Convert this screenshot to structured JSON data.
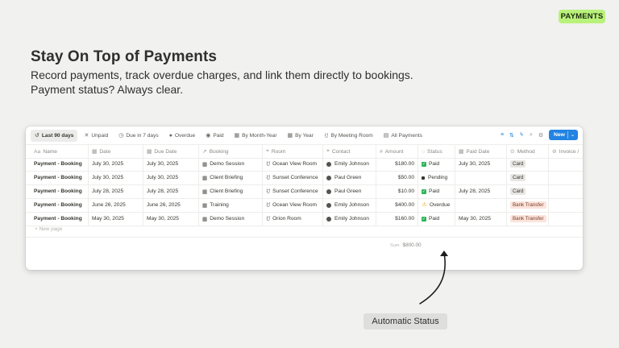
{
  "badge": "PAYMENTS",
  "hero": {
    "title": "Stay On Top of Payments",
    "subtitle_line1": "Record payments, track overdue charges, and link them directly to bookings.",
    "subtitle_line2": "Payment status? Always clear."
  },
  "views": [
    {
      "label": "Last 90 days",
      "icon": "history-icon",
      "active": true
    },
    {
      "label": "Unpaid",
      "icon": "x-icon"
    },
    {
      "label": "Due in 7 days",
      "icon": "clock-icon"
    },
    {
      "label": "Overdue",
      "icon": "alert-icon"
    },
    {
      "label": "Paid",
      "icon": "check-circle-icon"
    },
    {
      "label": "By Month-Year",
      "icon": "calendar-icon"
    },
    {
      "label": "By Year",
      "icon": "calendar-icon"
    },
    {
      "label": "By Meeting Room",
      "icon": "people-icon"
    },
    {
      "label": "All Payments",
      "icon": "table-icon"
    }
  ],
  "toolbar": {
    "new_label": "New",
    "tools": [
      "filter-icon",
      "sort-icon",
      "lightning-icon",
      "search-icon",
      "settings-icon"
    ]
  },
  "columns": {
    "name": "Name",
    "date": "Date",
    "due": "Due Date",
    "booking": "Booking",
    "room": "Room",
    "contact": "Contact",
    "amount": "Amount",
    "status": "Status",
    "paid_date": "Paid Date",
    "method": "Method",
    "invoice": "Invoice /"
  },
  "rows": [
    {
      "name": "Payment - Booking",
      "date": "July 30, 2025",
      "due": "July 30, 2025",
      "booking": "Demo Session",
      "room": "Ocean View Room",
      "contact": "Emily Johnson",
      "amount": "$180.00",
      "status": "Paid",
      "paid_date": "July 30, 2025",
      "method": "Card"
    },
    {
      "name": "Payment - Booking",
      "date": "July 30, 2025",
      "due": "July 30, 2025",
      "booking": "Client Briefing",
      "room": "Sunset Conference",
      "contact": "Paul Green",
      "amount": "$50.00",
      "status": "Pending",
      "paid_date": "",
      "method": "Card"
    },
    {
      "name": "Payment - Booking",
      "date": "July 28, 2025",
      "due": "July 28, 2025",
      "booking": "Client Briefing",
      "room": "Sunset Conference",
      "contact": "Paul Green",
      "amount": "$10.00",
      "status": "Paid",
      "paid_date": "July 28, 2025",
      "method": "Card"
    },
    {
      "name": "Payment - Booking",
      "date": "June 26, 2025",
      "due": "June 26, 2025",
      "booking": "Training",
      "room": "Ocean View Room",
      "contact": "Emily Johnson",
      "amount": "$400.00",
      "status": "Overdue",
      "paid_date": "",
      "method": "Bank Transfer"
    },
    {
      "name": "Payment - Booking",
      "date": "May 30, 2025",
      "due": "May 30, 2025",
      "booking": "Demo Session",
      "room": "Orion Room",
      "contact": "Emily Johnson",
      "amount": "$160.00",
      "status": "Paid",
      "paid_date": "May 30, 2025",
      "method": "Bank Transfer"
    }
  ],
  "new_page": "+ New page",
  "summary": {
    "label": "Sum",
    "value": "$800.00"
  },
  "annotation": "Automatic Status"
}
